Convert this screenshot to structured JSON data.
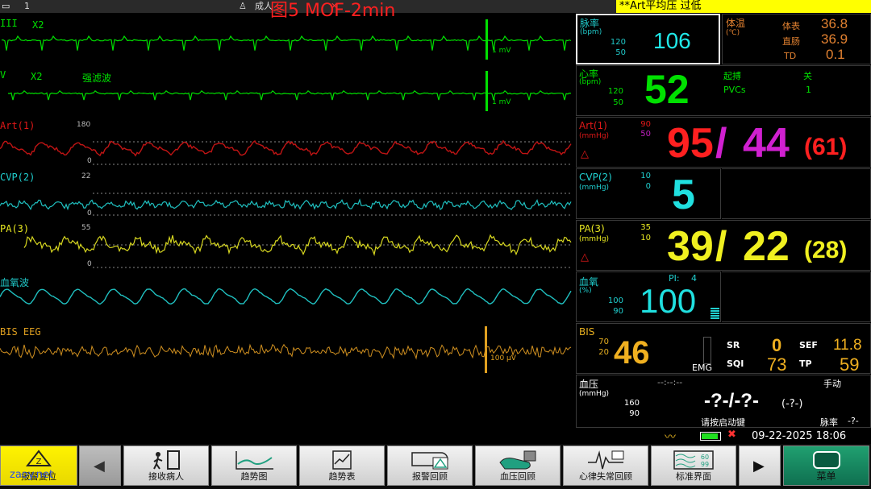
{
  "topbar": {
    "bed_no": "1",
    "patient_type": "成人",
    "alarm_text": "**Art平均压 过低"
  },
  "figure_title": "图5 MOF-2min",
  "waves": {
    "ecg1": {
      "label": "III",
      "gain": "X2",
      "scale": "1 mV"
    },
    "ecg2": {
      "label": "V",
      "gain": "X2",
      "filter": "强滤波",
      "scale": "1 mV"
    },
    "art": {
      "label": "Art(1)",
      "top": "180",
      "bottom": "0"
    },
    "cvp": {
      "label": "CVP(2)",
      "top": "22",
      "bottom": "0"
    },
    "pa": {
      "label": "PA(3)",
      "top": "55",
      "bottom": "0"
    },
    "spo2": {
      "label": "血氧波"
    },
    "eeg": {
      "label": "BIS EEG",
      "scale": "100 μV"
    }
  },
  "params": {
    "pr": {
      "label": "脉率",
      "unit": "(bpm)",
      "hi": "120",
      "lo": "50",
      "value": "106"
    },
    "temp": {
      "label": "体温",
      "unit": "(℃)",
      "r1_label": "体表",
      "r1": "36.8",
      "r2_label": "直肠",
      "r2": "36.9",
      "r3_label": "TD",
      "r3": "0.1"
    },
    "hr": {
      "label": "心率",
      "unit": "(bpm)",
      "hi": "120",
      "lo": "50",
      "value": "52",
      "pace_label": "起搏",
      "pace_val": "关",
      "pvc_label": "PVCs",
      "pvc_val": "1"
    },
    "art": {
      "label": "Art(1)",
      "unit": "(mmHg)",
      "hi": "90",
      "lo": "50",
      "sys": "95",
      "dia": "44",
      "mean": "(61)",
      "slash": "/"
    },
    "cvp": {
      "label": "CVP(2)",
      "unit": "(mmHg)",
      "hi": "10",
      "lo": "0",
      "value": "5"
    },
    "pa": {
      "label": "PA(3)",
      "unit": "(mmHg)",
      "hi": "35",
      "lo": "10",
      "sys": "39",
      "dia": "22",
      "mean": "(28)",
      "slash": "/"
    },
    "spo2": {
      "label": "血氧",
      "unit": "(%)",
      "hi": "100",
      "lo": "90",
      "value": "100",
      "pi_label": "PI:",
      "pi": "4"
    },
    "bis": {
      "label": "BIS",
      "hi": "70",
      "lo": "20",
      "value": "46",
      "emg": "EMG",
      "sr_label": "SR",
      "sr": "0",
      "sef_label": "SEF",
      "sef": "11.8",
      "sqi_label": "SQI",
      "sqi": "73",
      "tp_label": "TP",
      "tp": "59"
    },
    "nibp": {
      "label": "血压",
      "unit": "(mmHg)",
      "hi": "160",
      "lo": "90",
      "time": "--:--:--",
      "mode": "手动",
      "value": "-?-/-?-",
      "mean": "(-?-)",
      "hint": "请按启动键",
      "pr_label": "脉率",
      "pr": "-?-"
    }
  },
  "status": {
    "datetime": "09-22-2025 18:06"
  },
  "watermark": "zaoy.net",
  "buttons": [
    {
      "label": "报警复位",
      "icon": "alarm-reset-icon"
    },
    {
      "label": "",
      "icon": "left-arrow-icon"
    },
    {
      "label": "接收病人",
      "icon": "admit-patient-icon"
    },
    {
      "label": "趋势图",
      "icon": "trend-graph-icon"
    },
    {
      "label": "趋势表",
      "icon": "trend-table-icon"
    },
    {
      "label": "报警回顾",
      "icon": "alarm-review-icon"
    },
    {
      "label": "血压回顾",
      "icon": "nibp-review-icon"
    },
    {
      "label": "心律失常回顾",
      "icon": "arrhythmia-review-icon"
    },
    {
      "label": "标准界面",
      "icon": "standard-screen-icon"
    },
    {
      "label": "",
      "icon": "right-arrow-icon"
    },
    {
      "label": "菜单",
      "icon": "menu-icon"
    }
  ],
  "colors": {
    "ecg": "#00e000",
    "art": "#e01818",
    "cvp": "#20d0d0",
    "pa": "#e8e820",
    "spo2": "#20c8c8",
    "eeg": "#e0a020",
    "mean_art": "#ff3030",
    "dia_art": "#d020d0"
  }
}
